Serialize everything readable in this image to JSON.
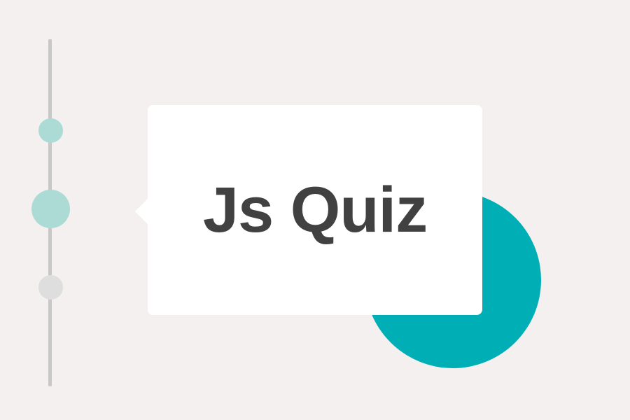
{
  "colors": {
    "background": "#f5f0f0",
    "timeline_line": "#c8c8c8",
    "node_active": "#acdbd6",
    "node_inactive": "#dedede",
    "accent_circle": "#00aeb5",
    "card": "#ffffff",
    "title_text": "#414141"
  },
  "timeline": {
    "nodes": [
      {
        "state": "active"
      },
      {
        "state": "current"
      },
      {
        "state": "inactive"
      }
    ]
  },
  "card": {
    "title": "Js Quiz"
  }
}
